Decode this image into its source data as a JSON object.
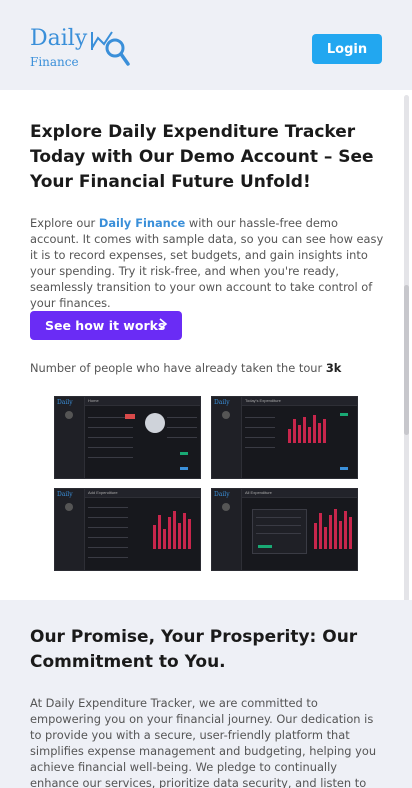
{
  "header": {
    "logo_word": "Daily",
    "logo_sub": "Finance",
    "login_label": "Login"
  },
  "hero": {
    "title": "Explore Daily Expenditure Tracker Today with Our Demo Account – See Your Financial Future Unfold!",
    "text_before": "Explore our ",
    "text_brand": "Daily Finance",
    "text_after": " with our hassle-free demo account. It comes with sample data, so you can see how easy it is to record expenses, set budgets, and gain insights into your spending. Try it risk-free, and when you're ready, seamlessly transition to your own account to take control of your finances.",
    "cta_label": "See how it works",
    "tour_label": "Number of people who have already taken the tour",
    "tour_count": "3k"
  },
  "screens": [
    {
      "name": "home-screenshot",
      "title": "Home"
    },
    {
      "name": "today-expenditure-screenshot",
      "title": "Today's Expenditure"
    },
    {
      "name": "add-expenditure-screenshot",
      "title": "Add Expenditure"
    },
    {
      "name": "all-expenditure-screenshot",
      "title": "All Expenditure"
    }
  ],
  "promise": {
    "title": "Our Promise, Your Prosperity: Our Commitment to You.",
    "text": "At Daily Expenditure Tracker, we are committed to empowering you on your financial journey. Our dedication is to provide you with a secure, user-friendly platform that simplifies expense management and budgeting, helping you achieve financial well-being. We pledge to continually enhance our services, prioritize data security, and listen to your feedback. Your"
  },
  "colors": {
    "accent": "#22a7f0",
    "cta": "#6a2cf5",
    "brand": "#3a8fd9",
    "bar": "#c8264c",
    "income": "#19a974"
  },
  "icons": [
    "logo-magnifier-icon",
    "chevron-right-icon"
  ]
}
